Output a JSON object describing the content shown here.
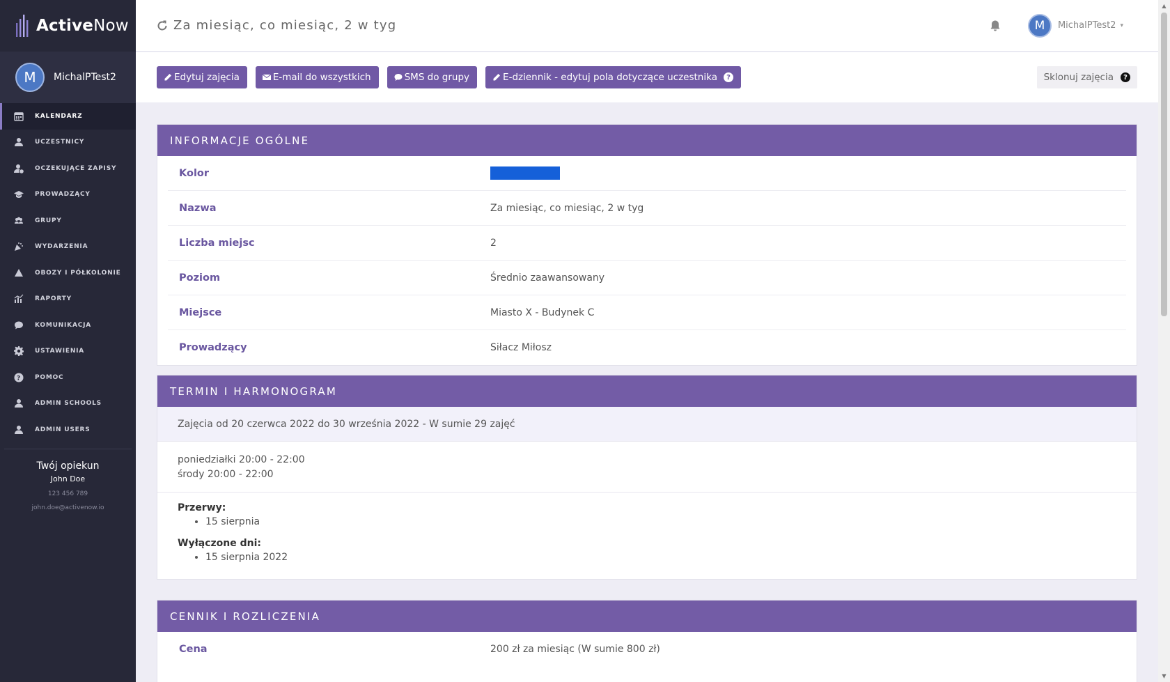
{
  "app": {
    "logo_bold": "Active",
    "logo_light": "Now"
  },
  "sidebar": {
    "user_initial": "M",
    "user_name": "MichalPTest2",
    "items": [
      {
        "label": "KALENDARZ",
        "icon": "calendar-icon"
      },
      {
        "label": "UCZESTNICY",
        "icon": "user-icon"
      },
      {
        "label": "OCZEKUJĄCE ZAPISY",
        "icon": "user-clock-icon"
      },
      {
        "label": "PROWADZĄCY",
        "icon": "graduation-cap-icon"
      },
      {
        "label": "GRUPY",
        "icon": "users-icon"
      },
      {
        "label": "WYDARZENIA",
        "icon": "party-icon"
      },
      {
        "label": "OBOZY I PÓŁKOLONIE",
        "icon": "tent-icon"
      },
      {
        "label": "RAPORTY",
        "icon": "chart-icon"
      },
      {
        "label": "KOMUNIKACJA",
        "icon": "chat-icon"
      },
      {
        "label": "USTAWIENIA",
        "icon": "gear-icon"
      },
      {
        "label": "POMOC",
        "icon": "help-icon"
      },
      {
        "label": "ADMIN SCHOOLS",
        "icon": "user-icon"
      },
      {
        "label": "ADMIN USERS",
        "icon": "user-icon"
      }
    ],
    "active_index": 0,
    "opiekun": {
      "title": "Twój opiekun",
      "name": "John Doe",
      "phone": "123 456 789",
      "email": "john.doe@activenow.io"
    }
  },
  "header": {
    "title": "Za miesiąc, co miesiąc, 2 w tyg",
    "user_initial": "M",
    "user_name": "MichalPTest2"
  },
  "toolbar": {
    "edit_label": "Edytuj zajęcia",
    "email_label": "E-mail do wszystkich",
    "sms_label": "SMS do grupy",
    "ediary_label": "E-dziennik - edytuj pola dotyczące uczestnika",
    "clone_label": "Sklonuj zajęcia"
  },
  "general": {
    "heading": "INFORMACJE OGÓLNE",
    "color_label": "Kolor",
    "color_value": "#1560d9",
    "rows": [
      {
        "label": "Nazwa",
        "value": "Za miesiąc, co miesiąc, 2 w tyg"
      },
      {
        "label": "Liczba miejsc",
        "value": "2"
      },
      {
        "label": "Poziom",
        "value": "Średnio zaawansowany"
      },
      {
        "label": "Miejsce",
        "value": "Miasto X - Budynek C"
      },
      {
        "label": "Prowadzący",
        "value": "Siłacz Miłosz"
      }
    ]
  },
  "schedule": {
    "heading": "TERMIN I HARMONOGRAM",
    "summary": "Zajęcia od 20 czerwca 2022 do 30 września 2022 - W sumie 29 zajęć",
    "day1": "poniedziałki 20:00 - 22:00",
    "day2": "środy 20:00 - 22:00",
    "breaks_label": "Przerwy:",
    "break1": "15 sierpnia",
    "excluded_label": "Wyłączone dni:",
    "excluded1": "15 sierpnia 2022"
  },
  "pricing": {
    "heading": "CENNIK I ROZLICZENIA",
    "price_label": "Cena",
    "price_value": "200 zł za miesiąc (W sumie 800 zł)"
  }
}
